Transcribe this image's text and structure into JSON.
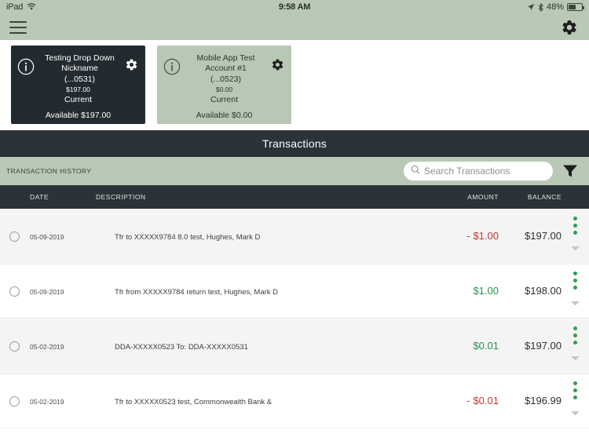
{
  "status_bar": {
    "device": "iPad",
    "wifi_icon": "wifi-icon",
    "time": "9:58 AM",
    "location_icon": "location-arrow-icon",
    "bluetooth_icon": "bluetooth-icon",
    "battery_percent": "48%",
    "battery_icon": "battery-icon"
  },
  "app_bar": {
    "menu_icon": "hamburger-menu-icon",
    "settings_icon": "gear-icon"
  },
  "accounts": [
    {
      "info_icon": "info-circle-icon",
      "name": "Testing Drop Down Nickname",
      "number": "(...0531)",
      "balance": "$197.00",
      "status": "Current",
      "available": "Available $197.00",
      "gear_icon": "gear-icon",
      "theme": "dark"
    },
    {
      "info_icon": "info-circle-icon",
      "name": "Mobile App Test Account #1",
      "number": "(...0523)",
      "balance": "$0.00",
      "status": "Current",
      "available": "Available $0.00",
      "gear_icon": "gear-icon",
      "theme": "green"
    }
  ],
  "section": {
    "title": "Transactions",
    "history_label": "TRANSACTION HISTORY",
    "search_placeholder": "Search Transactions",
    "search_value": "",
    "search_icon": "search-icon",
    "filter_icon": "filter-funnel-icon"
  },
  "table": {
    "columns": {
      "date": "DATE",
      "description": "DESCRIPTION",
      "amount": "AMOUNT",
      "balance": "BALANCE"
    },
    "rows": [
      {
        "date": "05-09-2019",
        "description": "Tfr to XXXXX9784 8.0 test, Hughes, Mark D",
        "amount": "- $1.00",
        "amount_sign": "neg",
        "balance": "$197.00",
        "menu_icon": "vertical-dots-menu-icon",
        "expand_icon": "chevron-down-icon"
      },
      {
        "date": "05-09-2019",
        "description": "Tfr from XXXXX9784 return test, Hughes, Mark D",
        "amount": "$1.00",
        "amount_sign": "pos",
        "balance": "$198.00",
        "menu_icon": "vertical-dots-menu-icon",
        "expand_icon": "chevron-down-icon"
      },
      {
        "date": "05-02-2019",
        "description": "DDA-XXXXX0523 To: DDA-XXXXX0531",
        "amount": "$0.01",
        "amount_sign": "pos",
        "balance": "$197.00",
        "menu_icon": "vertical-dots-menu-icon",
        "expand_icon": "chevron-down-icon"
      },
      {
        "date": "05-02-2019",
        "description": "Tfr to XXXXX0523 test, Commonwealth Bank &",
        "amount": "- $0.01",
        "amount_sign": "neg",
        "balance": "$196.99",
        "menu_icon": "vertical-dots-menu-icon",
        "expand_icon": "chevron-down-icon"
      }
    ]
  },
  "colors": {
    "header_green": "#b9c9b6",
    "dark_panel": "#2b3338",
    "card_dark": "#232b30",
    "positive": "#27924a",
    "negative": "#c0392b",
    "dot_green": "#2f9e4f"
  }
}
